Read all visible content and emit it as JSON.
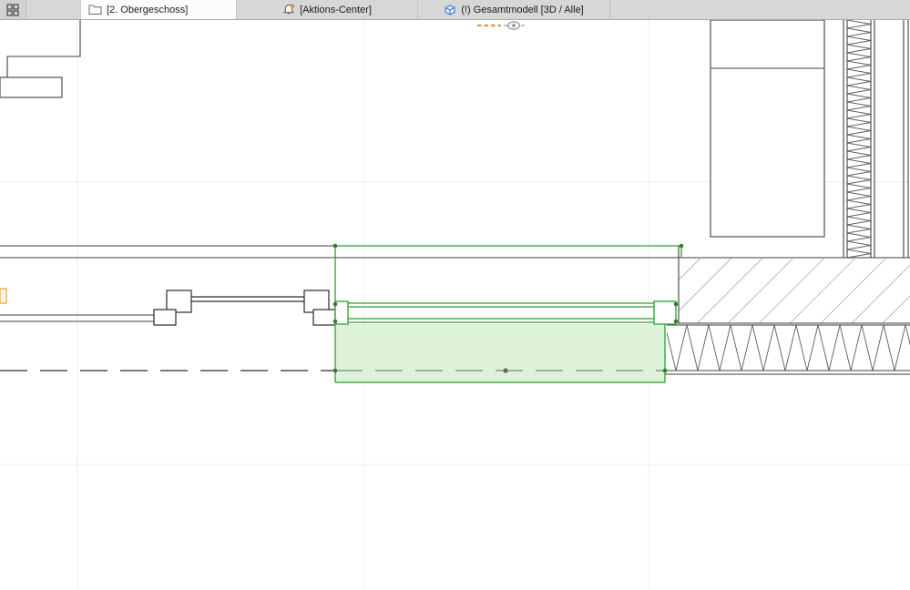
{
  "tabbar": {
    "overview_button": {
      "icon": "tab-overview-grid-icon"
    },
    "tabs": [
      {
        "label": "[2. Obergeschoss]",
        "icon": "folder-icon",
        "active": true
      },
      {
        "label": "[Aktions-Center]",
        "icon": "bell-alert-icon",
        "active": false
      },
      {
        "label": "(!) Gesamtmodell [3D / Alle]",
        "icon": "model-3d-icon",
        "active": false
      }
    ]
  },
  "canvas": {
    "trace_reference_indicator": {
      "icons": [
        "orange-dashed-line-icon",
        "eye-icon"
      ]
    },
    "selection": {
      "outline_color": "#2f9e2f",
      "fill_color": "#ddf2d8",
      "handle_color": "#2f7d2f"
    },
    "colors": {
      "drawing_line": "#3f3f3f",
      "grid_guide": "#efefef",
      "edge_marker_orange": "#e8a33d",
      "bell_badge_orange": "#e8862d",
      "model_icon_blue": "#3a7bd5"
    }
  }
}
